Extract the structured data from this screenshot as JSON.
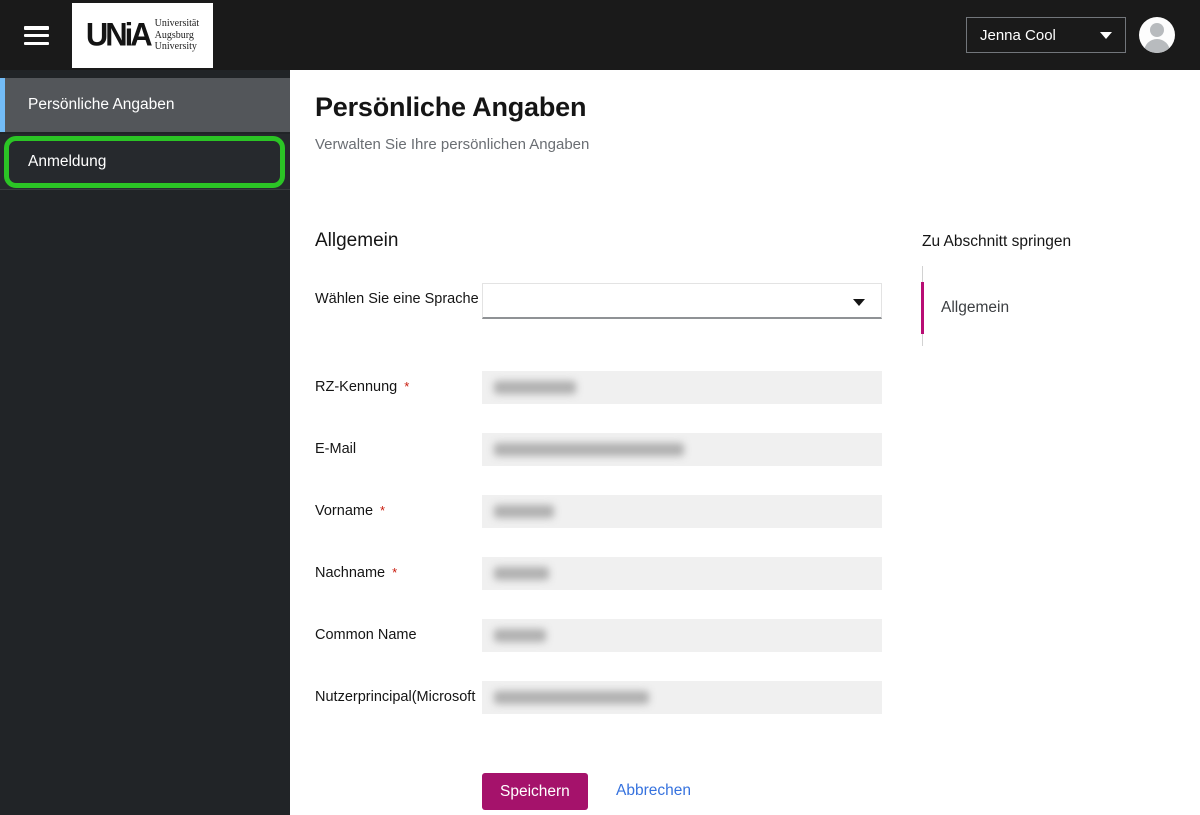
{
  "topbar": {
    "logo": {
      "mark": "UNiA",
      "line1": "Universität",
      "line2": "Augsburg",
      "line3": "University"
    },
    "user_name": "Jenna Cool"
  },
  "sidebar": {
    "item1": {
      "label": "Persönliche Angaben",
      "active": true
    },
    "item2": {
      "label": "Anmeldung",
      "highlighted": true
    }
  },
  "page": {
    "title": "Persönliche Angaben",
    "subtitle": "Verwalten Sie Ihre persönlichen Angaben"
  },
  "form": {
    "section_title": "Allgemein",
    "required_marker": "*",
    "fields": [
      {
        "label": "Wählen Sie eine Sprache",
        "type": "select",
        "value": "",
        "required": false
      },
      {
        "label": "RZ-Kennung",
        "required": true,
        "redacted": true
      },
      {
        "label": "E-Mail",
        "required": false,
        "redacted": true
      },
      {
        "label": "Vorname",
        "required": true,
        "redacted": true
      },
      {
        "label": "Nachname",
        "required": true,
        "redacted": true
      },
      {
        "label": "Common Name",
        "required": false,
        "redacted": true
      },
      {
        "label": "Nutzerprincipal(Microsoft",
        "required": false,
        "redacted": true
      }
    ],
    "save_label": "Speichern",
    "cancel_label": "Abbrechen"
  },
  "jump_nav": {
    "heading": "Zu Abschnitt springen",
    "active_item": "Allgemein"
  },
  "colors": {
    "topbar_bg": "#1a1a1a",
    "sidebar_bg": "#212427",
    "sidebar_active_indicator": "#73bcf7",
    "accent_magenta": "#a5126b",
    "jump_rail_active": "#b80d74",
    "link_blue": "#3672de",
    "required_red": "#c9190b",
    "highlight_annotation_green": "#2bc425",
    "disabled_input_bg": "#f0f0f0"
  }
}
